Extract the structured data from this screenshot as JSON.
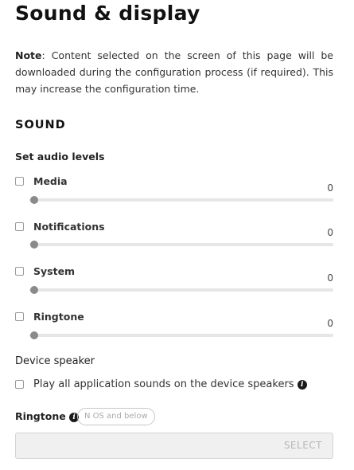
{
  "page": {
    "title": "Sound & display",
    "note_label": "Note",
    "note_text": ": Content selected on the screen of this page will be downloaded during the configuration process (if required). This may increase the configuration time."
  },
  "sound": {
    "section_title": "SOUND",
    "audio_levels_label": "Set audio levels",
    "levels": [
      {
        "label": "Media",
        "value": "0",
        "level": 0
      },
      {
        "label": "Notifications",
        "value": "0",
        "level": 0
      },
      {
        "label": "System",
        "value": "0",
        "level": 0
      },
      {
        "label": "Ringtone",
        "value": "0",
        "level": 0
      }
    ],
    "device_speaker_label": "Device speaker",
    "device_speaker_option": "Play all application sounds on the device speakers",
    "ringtone_label": "Ringtone",
    "ringtone_badge": "N OS and below",
    "ringtone_select_label": "SELECT"
  },
  "icons": {
    "info": "info-icon",
    "info_glyph": "i"
  },
  "colors": {
    "slider_thumb": "#8a8a8a",
    "slider_track": "#e6e6e6",
    "select_bg": "#f0f0f0"
  }
}
